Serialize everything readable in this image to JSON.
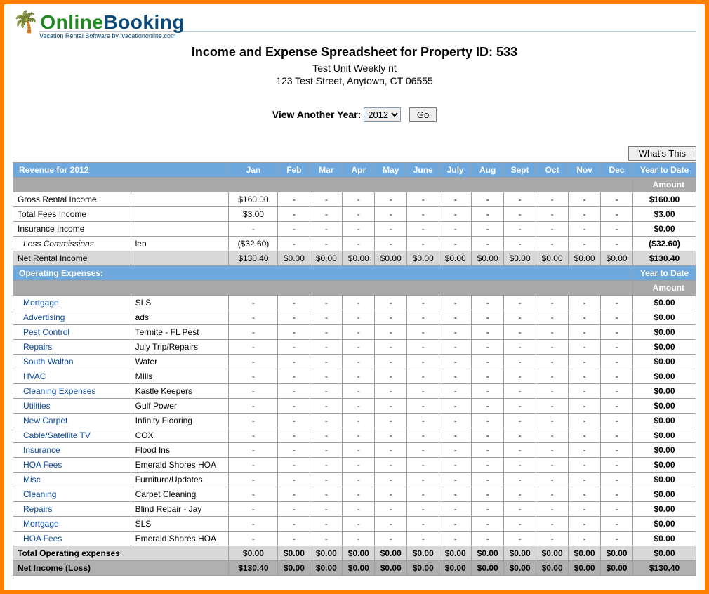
{
  "logo": {
    "online": "Online",
    "booking": "Booking",
    "sub": "Vacation Rental Software by ivacationonline.com"
  },
  "header": {
    "title": "Income and Expense Spreadsheet for Property ID: 533",
    "unit": "Test Unit Weekly rit",
    "address": "123 Test Street, Anytown, CT 06555"
  },
  "yearSelector": {
    "label": "View Another Year:",
    "value": "2012",
    "go": "Go"
  },
  "whatsThis": "What's This",
  "months": [
    "Jan",
    "Feb",
    "Mar",
    "Apr",
    "May",
    "June",
    "July",
    "Aug",
    "Sept",
    "Oct",
    "Nov",
    "Dec"
  ],
  "revenueHeader": "Revenue for 2012",
  "ytdHeader": "Year to Date",
  "amountHeader": "Amount",
  "revenueRows": [
    {
      "label": "Gross Rental Income",
      "vendor": "",
      "jan": "$160.00",
      "rest": "-",
      "ytd": "$160.00",
      "link": false
    },
    {
      "label": "Total Fees Income",
      "vendor": "",
      "jan": "$3.00",
      "rest": "-",
      "ytd": "$3.00",
      "link": false
    },
    {
      "label": "Insurance Income",
      "vendor": "",
      "jan": "-",
      "rest": "-",
      "ytd": "$0.00",
      "link": false
    },
    {
      "label": "Less Commissions",
      "vendor": "len",
      "jan": "($32.60)",
      "rest": "-",
      "ytd": "($32.60)",
      "link": false,
      "indent": true,
      "italic": true
    }
  ],
  "netRental": {
    "label": "Net Rental Income",
    "jan": "$130.40",
    "rest": "$0.00",
    "ytd": "$130.40"
  },
  "expensesHeader": "Operating Expenses:",
  "expenseRows": [
    {
      "label": "Mortgage",
      "vendor": "SLS",
      "ytd": "$0.00"
    },
    {
      "label": "Advertising",
      "vendor": "ads",
      "ytd": "$0.00"
    },
    {
      "label": "Pest Control",
      "vendor": "Termite - FL Pest",
      "ytd": "$0.00"
    },
    {
      "label": "Repairs",
      "vendor": "July Trip/Repairs",
      "ytd": "$0.00"
    },
    {
      "label": "South Walton",
      "vendor": "Water",
      "ytd": "$0.00"
    },
    {
      "label": "HVAC",
      "vendor": "MIlls",
      "ytd": "$0.00"
    },
    {
      "label": "Cleaning Expenses",
      "vendor": "Kastle Keepers",
      "ytd": "$0.00"
    },
    {
      "label": "Utilities",
      "vendor": "Gulf Power",
      "ytd": "$0.00"
    },
    {
      "label": "New Carpet",
      "vendor": "Infinity Flooring",
      "ytd": "$0.00"
    },
    {
      "label": "Cable/Satellite TV",
      "vendor": "COX",
      "ytd": "$0.00"
    },
    {
      "label": "Insurance",
      "vendor": "Flood Ins",
      "ytd": "$0.00"
    },
    {
      "label": "HOA Fees",
      "vendor": "Emerald Shores HOA",
      "ytd": "$0.00"
    },
    {
      "label": "Misc",
      "vendor": "Furniture/Updates",
      "ytd": "$0.00"
    },
    {
      "label": "Cleaning",
      "vendor": "Carpet Cleaning",
      "ytd": "$0.00"
    },
    {
      "label": "Repairs",
      "vendor": "Blind Repair - Jay",
      "ytd": "$0.00"
    },
    {
      "label": "Mortgage",
      "vendor": "SLS",
      "ytd": "$0.00"
    },
    {
      "label": "HOA Fees",
      "vendor": "Emerald Shores HOA",
      "ytd": "$0.00"
    }
  ],
  "totalExpenses": {
    "label": "Total Operating expenses",
    "val": "$0.00",
    "ytd": "$0.00"
  },
  "netIncome": {
    "label": "Net Income (Loss)",
    "jan": "$130.40",
    "rest": "$0.00",
    "ytd": "$130.40"
  }
}
